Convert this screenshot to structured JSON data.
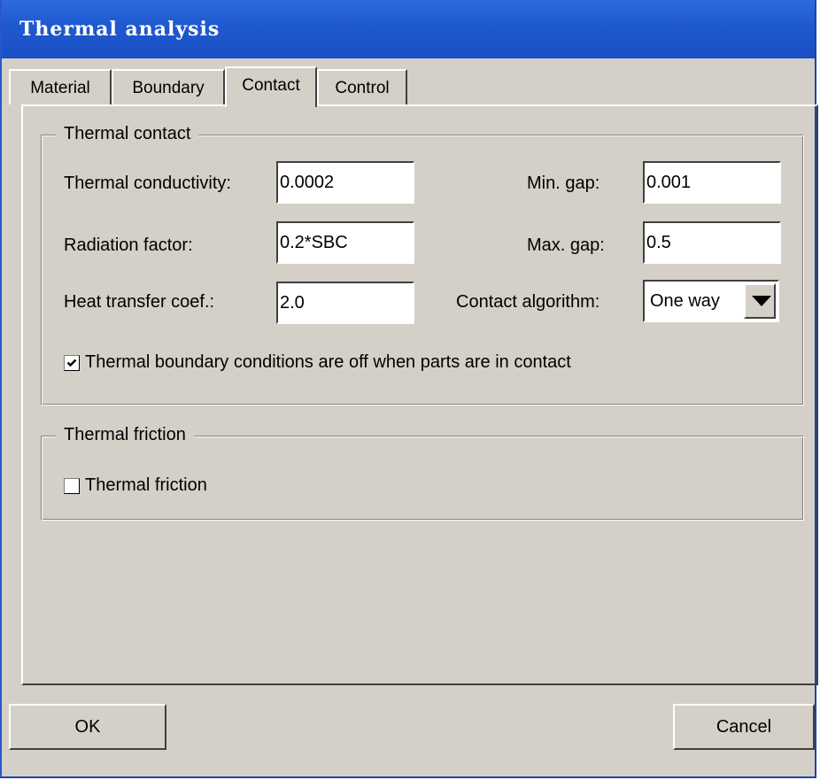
{
  "window": {
    "title": "Thermal analysis"
  },
  "tabs": [
    {
      "label": "Material",
      "active": false
    },
    {
      "label": "Boundary",
      "active": false
    },
    {
      "label": "Contact",
      "active": true
    },
    {
      "label": "Control",
      "active": false
    }
  ],
  "thermal_contact": {
    "legend": "Thermal contact",
    "conductivity_label": "Thermal conductivity:",
    "conductivity_value": "0.0002",
    "radiation_label": "Radiation factor:",
    "radiation_value": "0.2*SBC",
    "heat_transfer_label": "Heat transfer coef.:",
    "heat_transfer_value": "2.0",
    "min_gap_label": "Min. gap:",
    "min_gap_value": "0.001",
    "max_gap_label": "Max. gap:",
    "max_gap_value": "0.5",
    "algorithm_label": "Contact algorithm:",
    "algorithm_value": "One way",
    "bc_off_checked": true,
    "bc_off_label": "Thermal boundary conditions are off when parts are in contact"
  },
  "thermal_friction": {
    "legend": "Thermal friction",
    "checked": false,
    "label": "Thermal friction"
  },
  "buttons": {
    "ok": "OK",
    "cancel": "Cancel"
  },
  "colors": {
    "titlebar": "#1f5ad0",
    "face": "#d4d0c8"
  },
  "icons": {
    "dropdown": "chevron-down-icon",
    "check": "checkmark-icon"
  }
}
